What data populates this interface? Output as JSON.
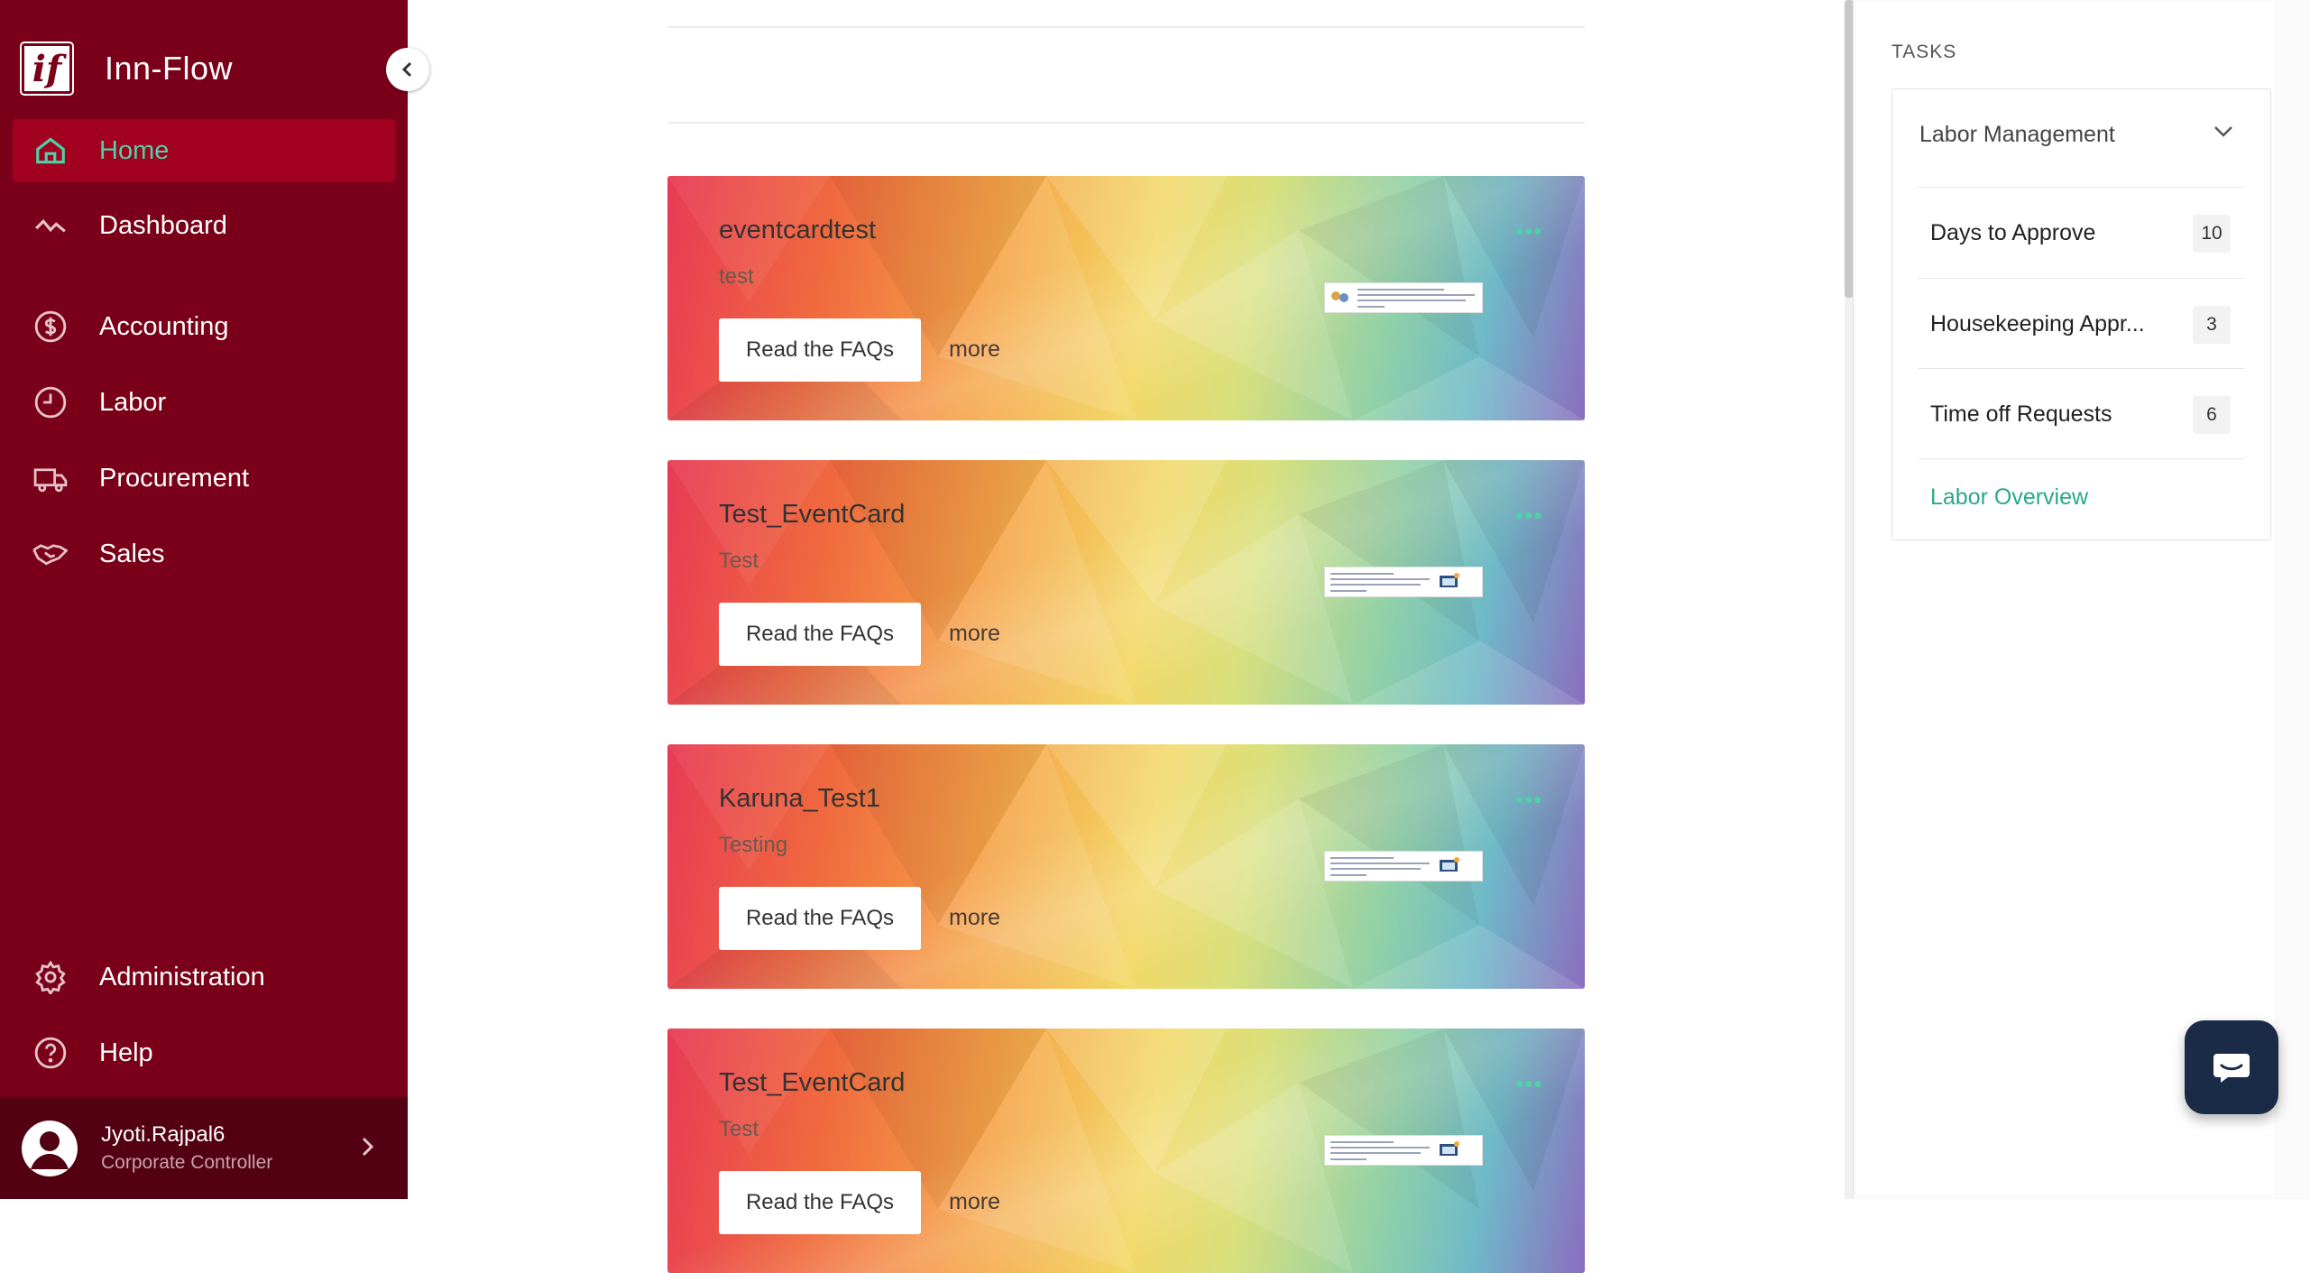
{
  "app": {
    "title": "Inn-Flow",
    "logo_text": "if"
  },
  "sidebar": {
    "items": [
      {
        "label": "Home",
        "icon": "home-icon",
        "active": true
      },
      {
        "label": "Dashboard",
        "icon": "pulse-icon"
      },
      {
        "label": "Accounting",
        "icon": "dollar-circle-icon"
      },
      {
        "label": "Labor",
        "icon": "clock-icon"
      },
      {
        "label": "Procurement",
        "icon": "truck-icon"
      },
      {
        "label": "Sales",
        "icon": "handshake-icon"
      },
      {
        "label": "Administration",
        "icon": "gear-icon"
      },
      {
        "label": "Help",
        "icon": "question-circle-icon"
      }
    ],
    "user": {
      "name": "Jyoti.Rajpal6",
      "role": "Corporate Controller"
    }
  },
  "feed": {
    "cards": [
      {
        "title": "eventcardtest",
        "subtitle": "test",
        "button": "Read the FAQs",
        "more": "more",
        "menu": "•••"
      },
      {
        "title": "Test_EventCard",
        "subtitle": "Test",
        "button": "Read the FAQs",
        "more": "more",
        "menu": "•••"
      },
      {
        "title": "Karuna_Test1",
        "subtitle": "Testing",
        "button": "Read the FAQs",
        "more": "more",
        "menu": "•••"
      },
      {
        "title": "Test_EventCard",
        "subtitle": "Test",
        "button": "Read the FAQs",
        "more": "more",
        "menu": "•••"
      }
    ]
  },
  "tasks": {
    "heading": "TASKS",
    "group": "Labor Management",
    "items": [
      {
        "label": "Days to Approve",
        "count": "10"
      },
      {
        "label": "Housekeeping Appr...",
        "count": "3"
      },
      {
        "label": "Time off Requests",
        "count": "6"
      }
    ],
    "link": "Labor Overview"
  },
  "colors": {
    "sidebar": "#7a0019",
    "active_item": "#a1001e",
    "accent": "#4fd1a8",
    "chat": "#1a2b47"
  }
}
